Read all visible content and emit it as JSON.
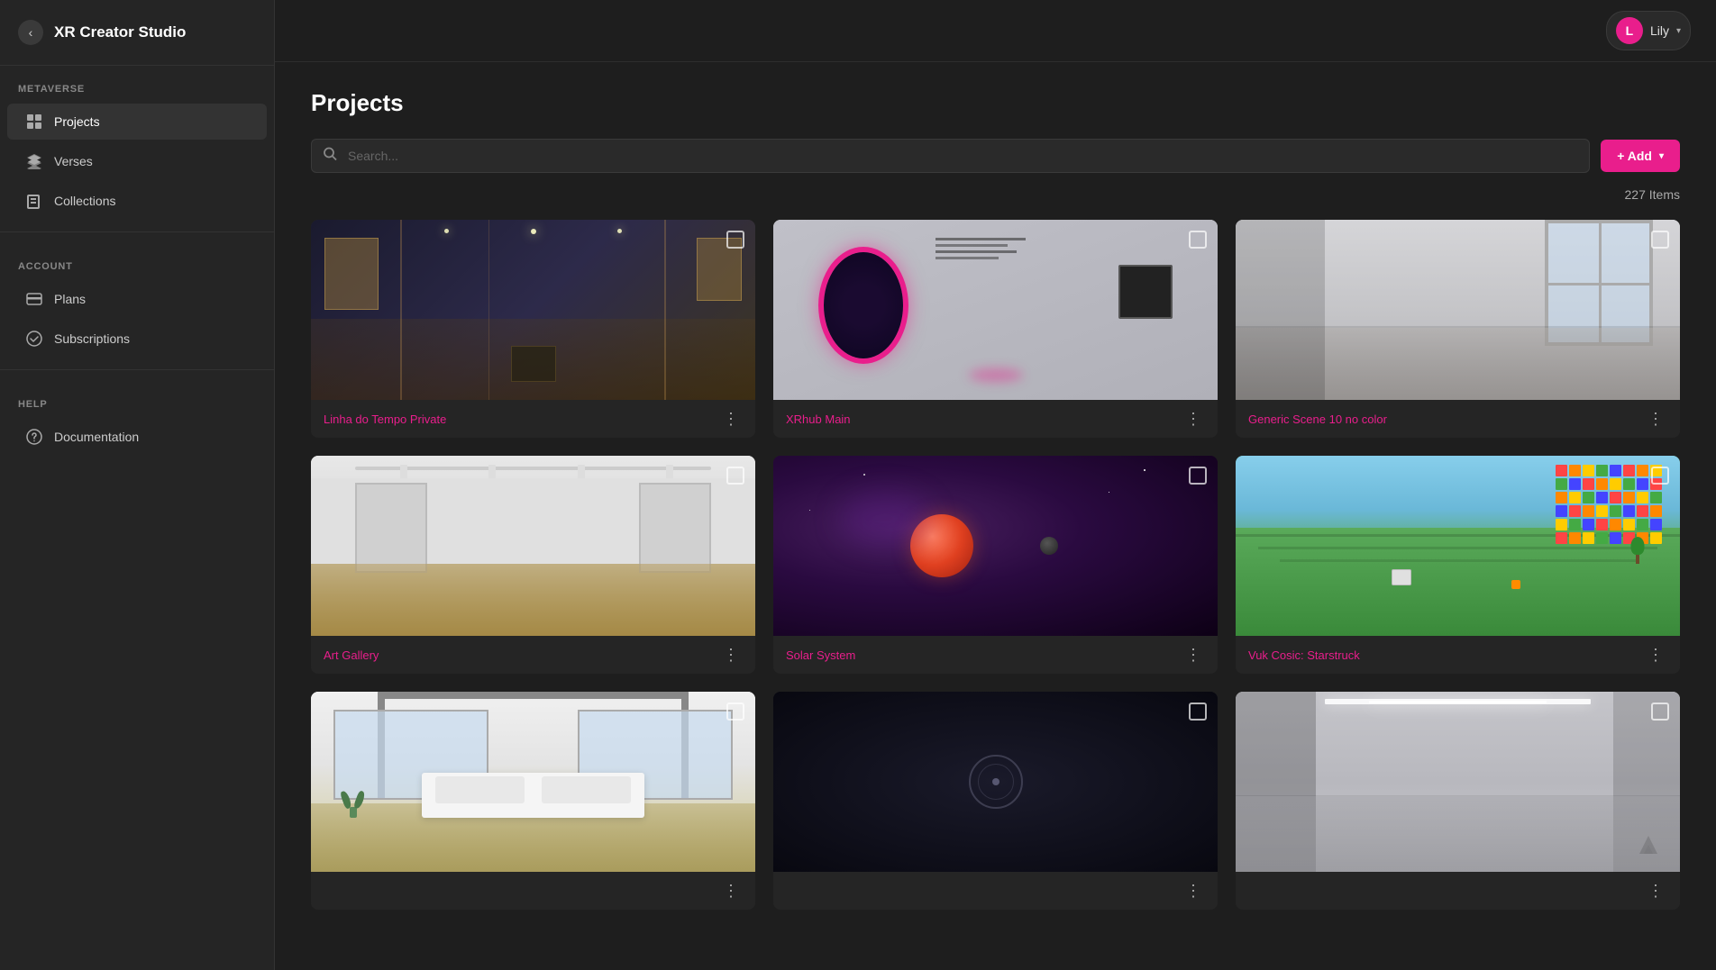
{
  "app": {
    "title": "XR Creator Studio"
  },
  "topbar": {
    "user": {
      "name": "Lily",
      "avatar_letter": "L",
      "avatar_color": "#e91e8c"
    }
  },
  "sidebar": {
    "back_label": "‹",
    "sections": [
      {
        "label": "METAVERSE",
        "items": [
          {
            "id": "projects",
            "label": "Projects",
            "icon": "grid",
            "active": true
          },
          {
            "id": "verses",
            "label": "Verses",
            "icon": "layers"
          },
          {
            "id": "collections",
            "label": "Collections",
            "icon": "book"
          }
        ]
      },
      {
        "label": "ACCOUNT",
        "items": [
          {
            "id": "plans",
            "label": "Plans",
            "icon": "creditcard"
          },
          {
            "id": "subscriptions",
            "label": "Subscriptions",
            "icon": "checkmark-circle"
          }
        ]
      },
      {
        "label": "HELP",
        "items": [
          {
            "id": "documentation",
            "label": "Documentation",
            "icon": "question-circle"
          }
        ]
      }
    ]
  },
  "main": {
    "page_title": "Projects",
    "search_placeholder": "Search...",
    "add_label": "+ Add",
    "items_count": "227 Items",
    "projects": [
      {
        "id": 1,
        "name": "Linha do Tempo Private",
        "thumb_type": "museo"
      },
      {
        "id": 2,
        "name": "XRhub Main",
        "thumb_type": "xrhub"
      },
      {
        "id": 3,
        "name": "Generic Scene 10 no color",
        "thumb_type": "generic"
      },
      {
        "id": 4,
        "name": "Art Gallery",
        "thumb_type": "artgallery"
      },
      {
        "id": 5,
        "name": "Solar System",
        "thumb_type": "solar"
      },
      {
        "id": 6,
        "name": "Vuk Cosic: Starstruck",
        "thumb_type": "vuk"
      },
      {
        "id": 7,
        "name": "",
        "thumb_type": "modern"
      },
      {
        "id": 8,
        "name": "",
        "thumb_type": "dark"
      },
      {
        "id": 9,
        "name": "",
        "thumb_type": "corridor"
      }
    ]
  }
}
